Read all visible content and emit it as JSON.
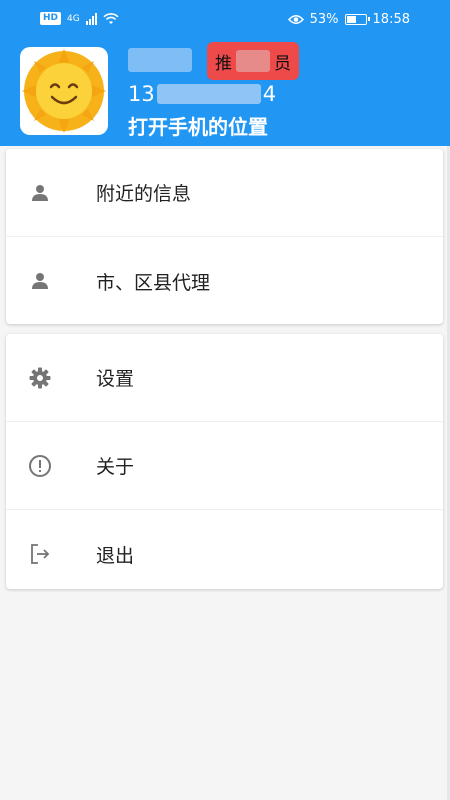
{
  "status_bar": {
    "hd": "HD",
    "network": "4G",
    "battery_percent_text": "53%",
    "battery_level": 0.53,
    "time": "18:58"
  },
  "profile": {
    "phone_visible_start": "13",
    "phone_visible_end": "4",
    "role_visible_start": "推",
    "role_visible_end": "员",
    "location_prompt": "打开手机的位置"
  },
  "menu_group_1": [
    {
      "label": "附近的信息",
      "icon": "person-icon"
    },
    {
      "label": "市、区县代理",
      "icon": "person-icon"
    }
  ],
  "menu_group_2": [
    {
      "label": "设置",
      "icon": "gear-icon"
    },
    {
      "label": "关于",
      "icon": "info-icon"
    },
    {
      "label": "退出",
      "icon": "logout-icon"
    }
  ],
  "colors": {
    "header": "#2196f3",
    "badge": "#ef4a4a",
    "icon": "#757575"
  }
}
